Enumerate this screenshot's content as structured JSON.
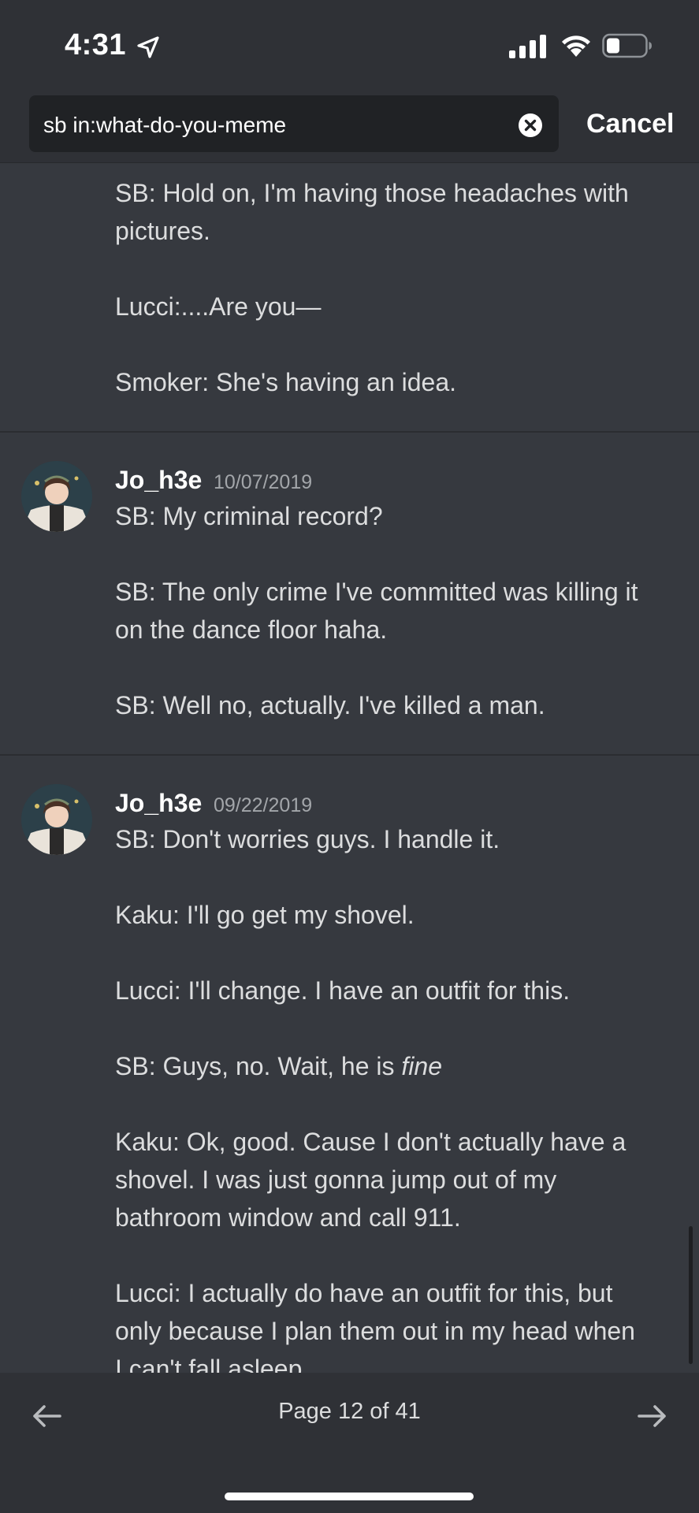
{
  "status_bar": {
    "time": "4:31"
  },
  "search": {
    "query": "sb in:what-do-you-meme",
    "cancel_label": "Cancel"
  },
  "results": [
    {
      "continued": true,
      "lines": [
        "SB: Hold on, I'm having those headaches with",
        "pictures.",
        "",
        "Lucci:....Are you—",
        "",
        "Smoker: She's having an idea."
      ]
    },
    {
      "author": "Jo_h3e",
      "timestamp": "10/07/2019",
      "lines": [
        "SB: My criminal record?",
        "",
        "SB: The only crime I've committed was killing it",
        "on the dance floor haha.",
        "",
        "SB: Well no, actually. I've killed a man."
      ]
    },
    {
      "author": "Jo_h3e",
      "timestamp": "09/22/2019",
      "lines": [
        "SB: Don't worries guys. I handle it.",
        "",
        "Kaku: I'll go get my shovel.",
        "",
        "Lucci: I'll change. I have an outfit for this.",
        "",
        "SB: Guys, no. Wait, he is ",
        "",
        "Kaku: Ok, good. Cause I don't actually have a",
        "shovel. I was just gonna jump out of my",
        "bathroom window and call 911.",
        "",
        "Lucci: I actually do  have an outfit for this, but",
        "only because I plan them out in my head when",
        "I can't fall asleep."
      ],
      "italic_word": "fine"
    }
  ],
  "pagination": {
    "label": "Page 12 of 41"
  },
  "icons": {
    "location": "location-arrow-icon",
    "signal": "cellular-signal-icon",
    "wifi": "wifi-icon",
    "battery": "battery-icon",
    "clear": "clear-search-icon",
    "prev": "arrow-left-icon",
    "next": "arrow-right-icon"
  },
  "colors": {
    "background": "#36393f",
    "header": "#2f3136",
    "input": "#202225",
    "text": "#dcddde",
    "timestamp": "#a3a6aa"
  }
}
